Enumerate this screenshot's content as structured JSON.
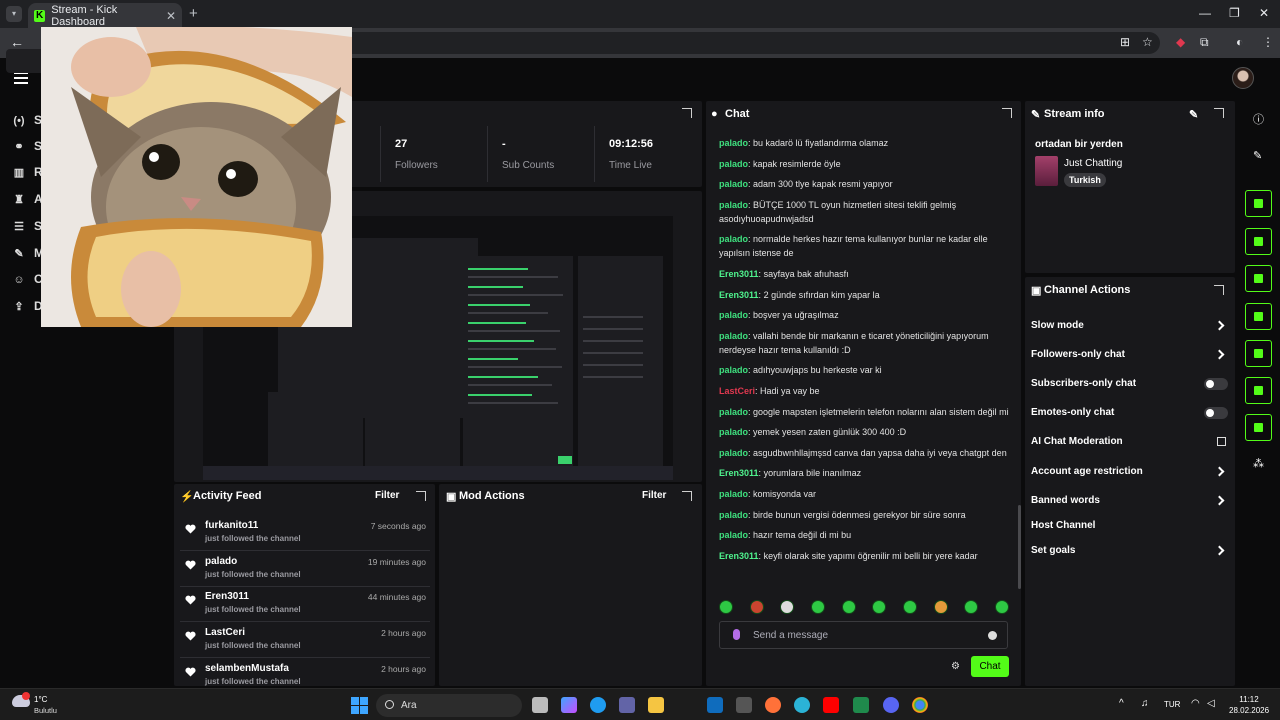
{
  "browser": {
    "tab_title": "Stream - Kick Dashboard",
    "tab_close": "✕",
    "new_tab": "+",
    "favicon_letter": "K"
  },
  "nav": {
    "items": [
      {
        "letter": "S",
        "icon": "broadcast-icon"
      },
      {
        "letter": "S",
        "icon": "link-icon"
      },
      {
        "letter": "R",
        "icon": "chart-icon"
      },
      {
        "letter": "A",
        "icon": "trophy-icon"
      },
      {
        "letter": "S",
        "icon": "settings-icon"
      },
      {
        "letter": "M",
        "icon": "wrench-icon"
      },
      {
        "letter": "C",
        "icon": "users-icon"
      },
      {
        "letter": "D",
        "icon": "upload-icon"
      }
    ]
  },
  "stats": {
    "followers": {
      "value": "27",
      "label": "Followers"
    },
    "subs": {
      "value": "-",
      "label": "Sub Counts"
    },
    "time_live": {
      "value": "09:12:56",
      "label": "Time Live"
    }
  },
  "chat": {
    "title": "Chat",
    "messages": [
      {
        "user": "palado",
        "kind": "palado",
        "text": "bu kadarö lü fiyatlandırma olamaz"
      },
      {
        "user": "palado",
        "kind": "palado",
        "text": "kapak resimlerde öyle"
      },
      {
        "user": "palado",
        "kind": "palado",
        "text": "adam 300 tlye kapak resmi yapıyor"
      },
      {
        "user": "palado",
        "kind": "palado",
        "text": "BÜTÇE 1000 TL oyun hizmetleri sitesi teklifi gelmiş asodıyhuoapudnwjadsd"
      },
      {
        "user": "palado",
        "kind": "palado",
        "text": "normalde herkes hazır tema kullanıyor bunlar ne kadar elle yapılsın istense de"
      },
      {
        "user": "Eren3011",
        "kind": "eren",
        "text": "sayfaya bak afıuhasfı"
      },
      {
        "user": "Eren3011",
        "kind": "eren",
        "text": "2 günde sıfırdan kim yapar la"
      },
      {
        "user": "palado",
        "kind": "palado",
        "text": "boşver ya uğraşılmaz"
      },
      {
        "user": "palado",
        "kind": "palado",
        "text": "vallahi bende bir markanın e ticaret yöneticiliğini yapıyorum nerdeyse hazır tema kullanıldı :D"
      },
      {
        "user": "palado",
        "kind": "palado",
        "text": "adıhyouwjaps bu herkeste var ki"
      },
      {
        "user": "LastCeri",
        "kind": "last",
        "text": "Hadi ya vay be"
      },
      {
        "user": "palado",
        "kind": "palado",
        "text": "google mapsten işletmelerin telefon nolarını alan sistem değil mi"
      },
      {
        "user": "palado",
        "kind": "palado",
        "text": "yemek yesen zaten günlük 300 400 :D"
      },
      {
        "user": "palado",
        "kind": "palado",
        "text": "asgudbwnhllajmşsd canva dan yapsa daha iyi veya chatgpt den"
      },
      {
        "user": "Eren3011",
        "kind": "eren",
        "text": "yorumlara bile inanılmaz"
      },
      {
        "user": "palado",
        "kind": "palado",
        "text": "komisyonda var"
      },
      {
        "user": "palado",
        "kind": "palado",
        "text": "birde bunun vergisi ödenmesi gerekyor bir süre sonra"
      },
      {
        "user": "palado",
        "kind": "palado",
        "text": "hazır tema değil di mi bu"
      },
      {
        "user": "Eren3011",
        "kind": "eren",
        "text": "keyfi olarak site yapımı öğrenilir mi belli bir yere kadar"
      }
    ],
    "input_placeholder": "Send a message",
    "send_label": "Chat"
  },
  "stream_info": {
    "title": "Stream info",
    "stream_title": "ortadan bir yerden",
    "category": "Just Chatting",
    "tag": "Turkish"
  },
  "channel_actions": {
    "title": "Channel Actions",
    "items": [
      {
        "label": "Slow mode",
        "control": "chevron"
      },
      {
        "label": "Followers-only chat",
        "control": "chevron"
      },
      {
        "label": "Subscribers-only chat",
        "control": "toggle"
      },
      {
        "label": "Emotes-only chat",
        "control": "toggle"
      },
      {
        "label": "AI Chat Moderation",
        "control": "external"
      },
      {
        "label": "Account age restriction",
        "control": "chevron"
      },
      {
        "label": "Banned words",
        "control": "chevron"
      },
      {
        "label": "Host Channel",
        "control": "none"
      },
      {
        "label": "Set goals",
        "control": "chevron"
      }
    ]
  },
  "activity_feed": {
    "title": "Activity Feed",
    "filter_label": "Filter",
    "items": [
      {
        "name": "furkanito11",
        "sub": "just followed the channel",
        "time": "7 seconds ago"
      },
      {
        "name": "palado",
        "sub": "just followed the channel",
        "time": "19 minutes ago"
      },
      {
        "name": "Eren3011",
        "sub": "just followed the channel",
        "time": "44 minutes ago"
      },
      {
        "name": "LastCeri",
        "sub": "just followed the channel",
        "time": "2 hours ago"
      },
      {
        "name": "selambenMustafa",
        "sub": "just followed the channel",
        "time": "2 hours ago"
      }
    ]
  },
  "mod_actions": {
    "title": "Mod Actions",
    "filter_label": "Filter"
  },
  "taskbar": {
    "temperature": "1°C",
    "weather": "Bulutlu",
    "search_placeholder": "Ara",
    "language": "TUR",
    "time": "11:12",
    "date": "28.02.2026"
  },
  "colors": {
    "accent": "#53fc18",
    "palado": "#3fe07f",
    "eren": "#4ff38e",
    "lastceri": "#e0384f"
  }
}
